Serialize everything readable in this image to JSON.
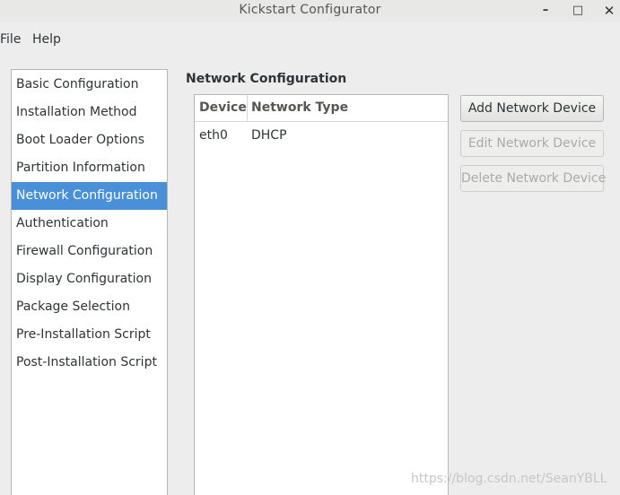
{
  "window": {
    "title": "Kickstart Configurator",
    "minimize_glyph": "–",
    "maximize_glyph": "□",
    "close_glyph": "✕"
  },
  "menu": {
    "file": "File",
    "help": "Help"
  },
  "sidebar": {
    "items": [
      {
        "label": "Basic Configuration"
      },
      {
        "label": "Installation Method"
      },
      {
        "label": "Boot Loader Options"
      },
      {
        "label": "Partition Information"
      },
      {
        "label": "Network Configuration"
      },
      {
        "label": "Authentication"
      },
      {
        "label": "Firewall Configuration"
      },
      {
        "label": "Display Configuration"
      },
      {
        "label": "Package Selection"
      },
      {
        "label": "Pre-Installation Script"
      },
      {
        "label": "Post-Installation Script"
      }
    ],
    "selected_index": 4
  },
  "main": {
    "section_title": "Network Configuration",
    "table": {
      "columns": [
        "Device",
        "Network Type"
      ],
      "rows": [
        {
          "device": "eth0",
          "type": "DHCP"
        }
      ]
    },
    "buttons": {
      "add": "Add Network Device",
      "edit": "Edit Network Device",
      "delete": "Delete Network Device"
    }
  },
  "watermark": "https://blog.csdn.net/SeanYBLL",
  "colors": {
    "selection": "#4a90d9",
    "window_bg": "#ededed"
  }
}
